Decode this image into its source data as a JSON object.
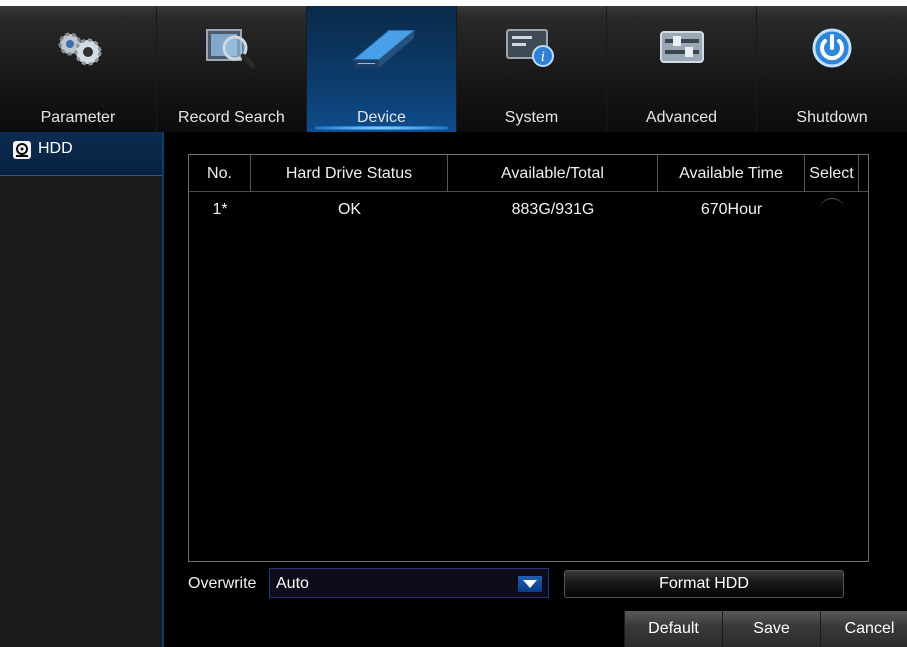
{
  "tabs": [
    {
      "label": "Parameter",
      "icon": "gears-icon",
      "active": false
    },
    {
      "label": "Record Search",
      "icon": "film-search-icon",
      "active": false
    },
    {
      "label": "Device",
      "icon": "hard-drive-icon",
      "active": true
    },
    {
      "label": "System",
      "icon": "system-info-icon",
      "active": false
    },
    {
      "label": "Advanced",
      "icon": "sliders-icon",
      "active": false
    },
    {
      "label": "Shutdown",
      "icon": "power-icon",
      "active": false
    }
  ],
  "sidebar": {
    "items": [
      {
        "label": "HDD",
        "icon": "hdd-icon",
        "active": true
      }
    ]
  },
  "table": {
    "headers": [
      "No.",
      "Hard Drive Status",
      "Available/Total",
      "Available Time",
      "Select"
    ],
    "rows": [
      {
        "no": "1*",
        "status": "OK",
        "available_total": "883G/931G",
        "available_time": "670Hour",
        "selected": false
      }
    ]
  },
  "overwrite": {
    "label": "Overwrite",
    "value": "Auto"
  },
  "buttons": {
    "format": "Format HDD",
    "default": "Default",
    "save": "Save",
    "cancel": "Cancel"
  },
  "colors": {
    "accent": "#0f4c8c",
    "background": "#000000",
    "sidebar": "#1b1b1b"
  }
}
